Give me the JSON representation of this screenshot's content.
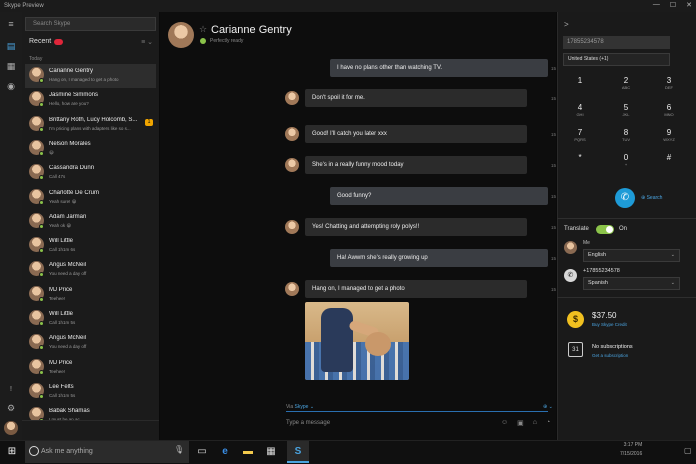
{
  "window": {
    "title": "Skype Preview",
    "controls": [
      "—",
      "☐",
      "✕"
    ]
  },
  "sidebar": {
    "search_placeholder": "Search Skype",
    "recent_label": "Recent",
    "tools": "≡ ⌄",
    "today_label": "Today",
    "contacts": [
      {
        "name": "Carianne Gentry",
        "sub": "Hang on, I managed to get a photo",
        "active": true
      },
      {
        "name": "Jasmine Simmons",
        "sub": "Hello, how are you?"
      },
      {
        "name": "Brittany Roth, Lucy Holcomb, S...",
        "sub": "I'm pricing plans with adapters like so s...",
        "badge": "1"
      },
      {
        "name": "Nelson Morales",
        "sub": "😀"
      },
      {
        "name": "Cassandra Dunn",
        "sub": "Call 47s"
      },
      {
        "name": "Charlotte De Crum",
        "sub": "Yeah sure! 😀"
      },
      {
        "name": "Adam Jarman",
        "sub": "Yeah ok 😀"
      },
      {
        "name": "Will Little",
        "sub": "Call 1h1m 6s"
      },
      {
        "name": "Angus McNeil",
        "sub": "You need a day off"
      },
      {
        "name": "MJ Price",
        "sub": "Teehee!"
      },
      {
        "name": "Will Little",
        "sub": "Call 1h1m 5s"
      },
      {
        "name": "Angus McNeil",
        "sub": "You need a day off"
      },
      {
        "name": "MJ Price",
        "sub": "Teehee!"
      },
      {
        "name": "Lee Felts",
        "sub": "Call 1h1m 5s"
      },
      {
        "name": "Babak Shamas",
        "sub": "I must be an ac..."
      }
    ]
  },
  "chat": {
    "contact_name": "Carianne Gentry",
    "contact_status": "Perfectly ready",
    "messages": [
      {
        "text": "I have no plans other than watching TV.",
        "from": "me",
        "time": "15"
      },
      {
        "text": "Don't spoil it for me.",
        "from": "them",
        "time": "15"
      },
      {
        "text": "Good! I'll catch you later xxx",
        "from": "them",
        "time": "15"
      },
      {
        "text": "She's in a really funny mood today",
        "from": "them",
        "time": "15"
      },
      {
        "text": "Good funny?",
        "from": "me",
        "time": "15"
      },
      {
        "text": "Yes! Chatting and attempting roly polys!!",
        "from": "them",
        "time": "15"
      },
      {
        "text": "Ha! Awwm she's really growing up",
        "from": "me",
        "time": "15"
      },
      {
        "text": "Hang on, I managed to get a photo",
        "from": "them",
        "time": "15"
      }
    ],
    "via_label": "Via",
    "via_service": "Skype ⌄",
    "via_right": "⊕ ⌄",
    "compose_placeholder": "Type a message",
    "compose_icons": [
      "☺",
      "▣",
      "⌂",
      "◔"
    ]
  },
  "dialer": {
    "back": ">",
    "number": "17855234578",
    "country": "United States (+1)",
    "keys": [
      {
        "d": "1",
        "l": ""
      },
      {
        "d": "2",
        "l": "ABC"
      },
      {
        "d": "3",
        "l": "DEF"
      },
      {
        "d": "4",
        "l": "GHI"
      },
      {
        "d": "5",
        "l": "JKL"
      },
      {
        "d": "6",
        "l": "MNO"
      },
      {
        "d": "7",
        "l": "PQRS"
      },
      {
        "d": "8",
        "l": "TUV"
      },
      {
        "d": "9",
        "l": "WXYZ"
      },
      {
        "d": "*",
        "l": ""
      },
      {
        "d": "0",
        "l": "+"
      },
      {
        "d": "#",
        "l": ""
      }
    ],
    "call_icon": "✆",
    "search_label": "⊕ Search"
  },
  "translate": {
    "label": "Translate",
    "state": "On",
    "me_label": "Me",
    "my_language": "English",
    "other_number": "+17855234578",
    "other_language": "Spanish",
    "caret": "⌄"
  },
  "credit": {
    "amount": "$37.50",
    "link": "Buy Skype Credit",
    "subs_title": "No subscriptions",
    "subs_link": "Get a subscription",
    "calendar_label": "31"
  },
  "taskbar": {
    "search_placeholder": "Ask me anything",
    "time": "3:17 PM",
    "date": "7/15/2016"
  }
}
